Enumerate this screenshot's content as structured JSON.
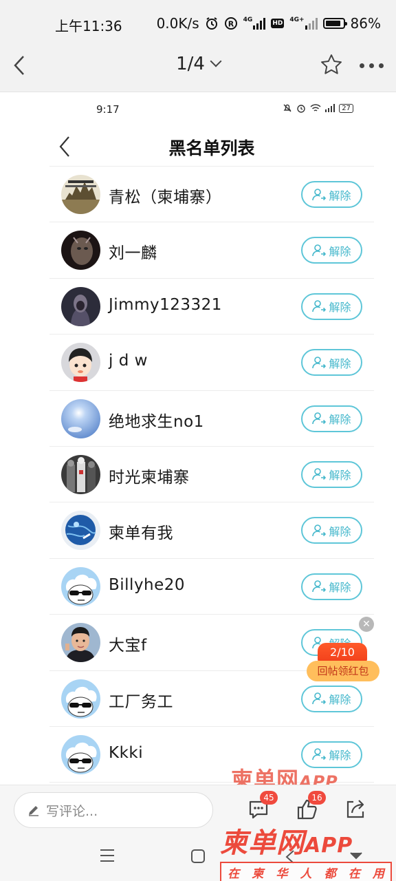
{
  "status_bar": {
    "time": "上午11:36",
    "net_speed": "0.0K/s",
    "network_a": "4G",
    "network_b": "4G+",
    "hd": "HD",
    "battery": "86%",
    "battery_level": 0.86
  },
  "nav": {
    "page_indicator": "1/4"
  },
  "inner": {
    "status_time": "9:17",
    "status_battery": "27",
    "title": "黑名单列表",
    "unblock_label": "解除",
    "users": [
      {
        "name": "青松（柬埔寨）"
      },
      {
        "name": "刘一麟"
      },
      {
        "name": "Jimmy123321"
      },
      {
        "name": "j d w"
      },
      {
        "name": "绝地求生no1"
      },
      {
        "name": "时光柬埔寨"
      },
      {
        "name": "柬单有我"
      },
      {
        "name": "Billyhe20"
      },
      {
        "name": "大宝f"
      },
      {
        "name": "工厂务工"
      },
      {
        "name": "Kkki"
      }
    ]
  },
  "promo": {
    "count": "2/10",
    "label": "回帖领红包"
  },
  "watermark": {
    "brand": "柬单网",
    "app": "APP",
    "slogan": [
      "在",
      "柬",
      "华",
      "人",
      "都",
      "在",
      "用"
    ]
  },
  "bottom_bar": {
    "comment_placeholder": "写评论...",
    "comment_count": "45",
    "like_count": "16"
  },
  "colors": {
    "accent": "#46b8cc",
    "badge": "#f04a3e",
    "watermark": "#ec4a3c"
  }
}
